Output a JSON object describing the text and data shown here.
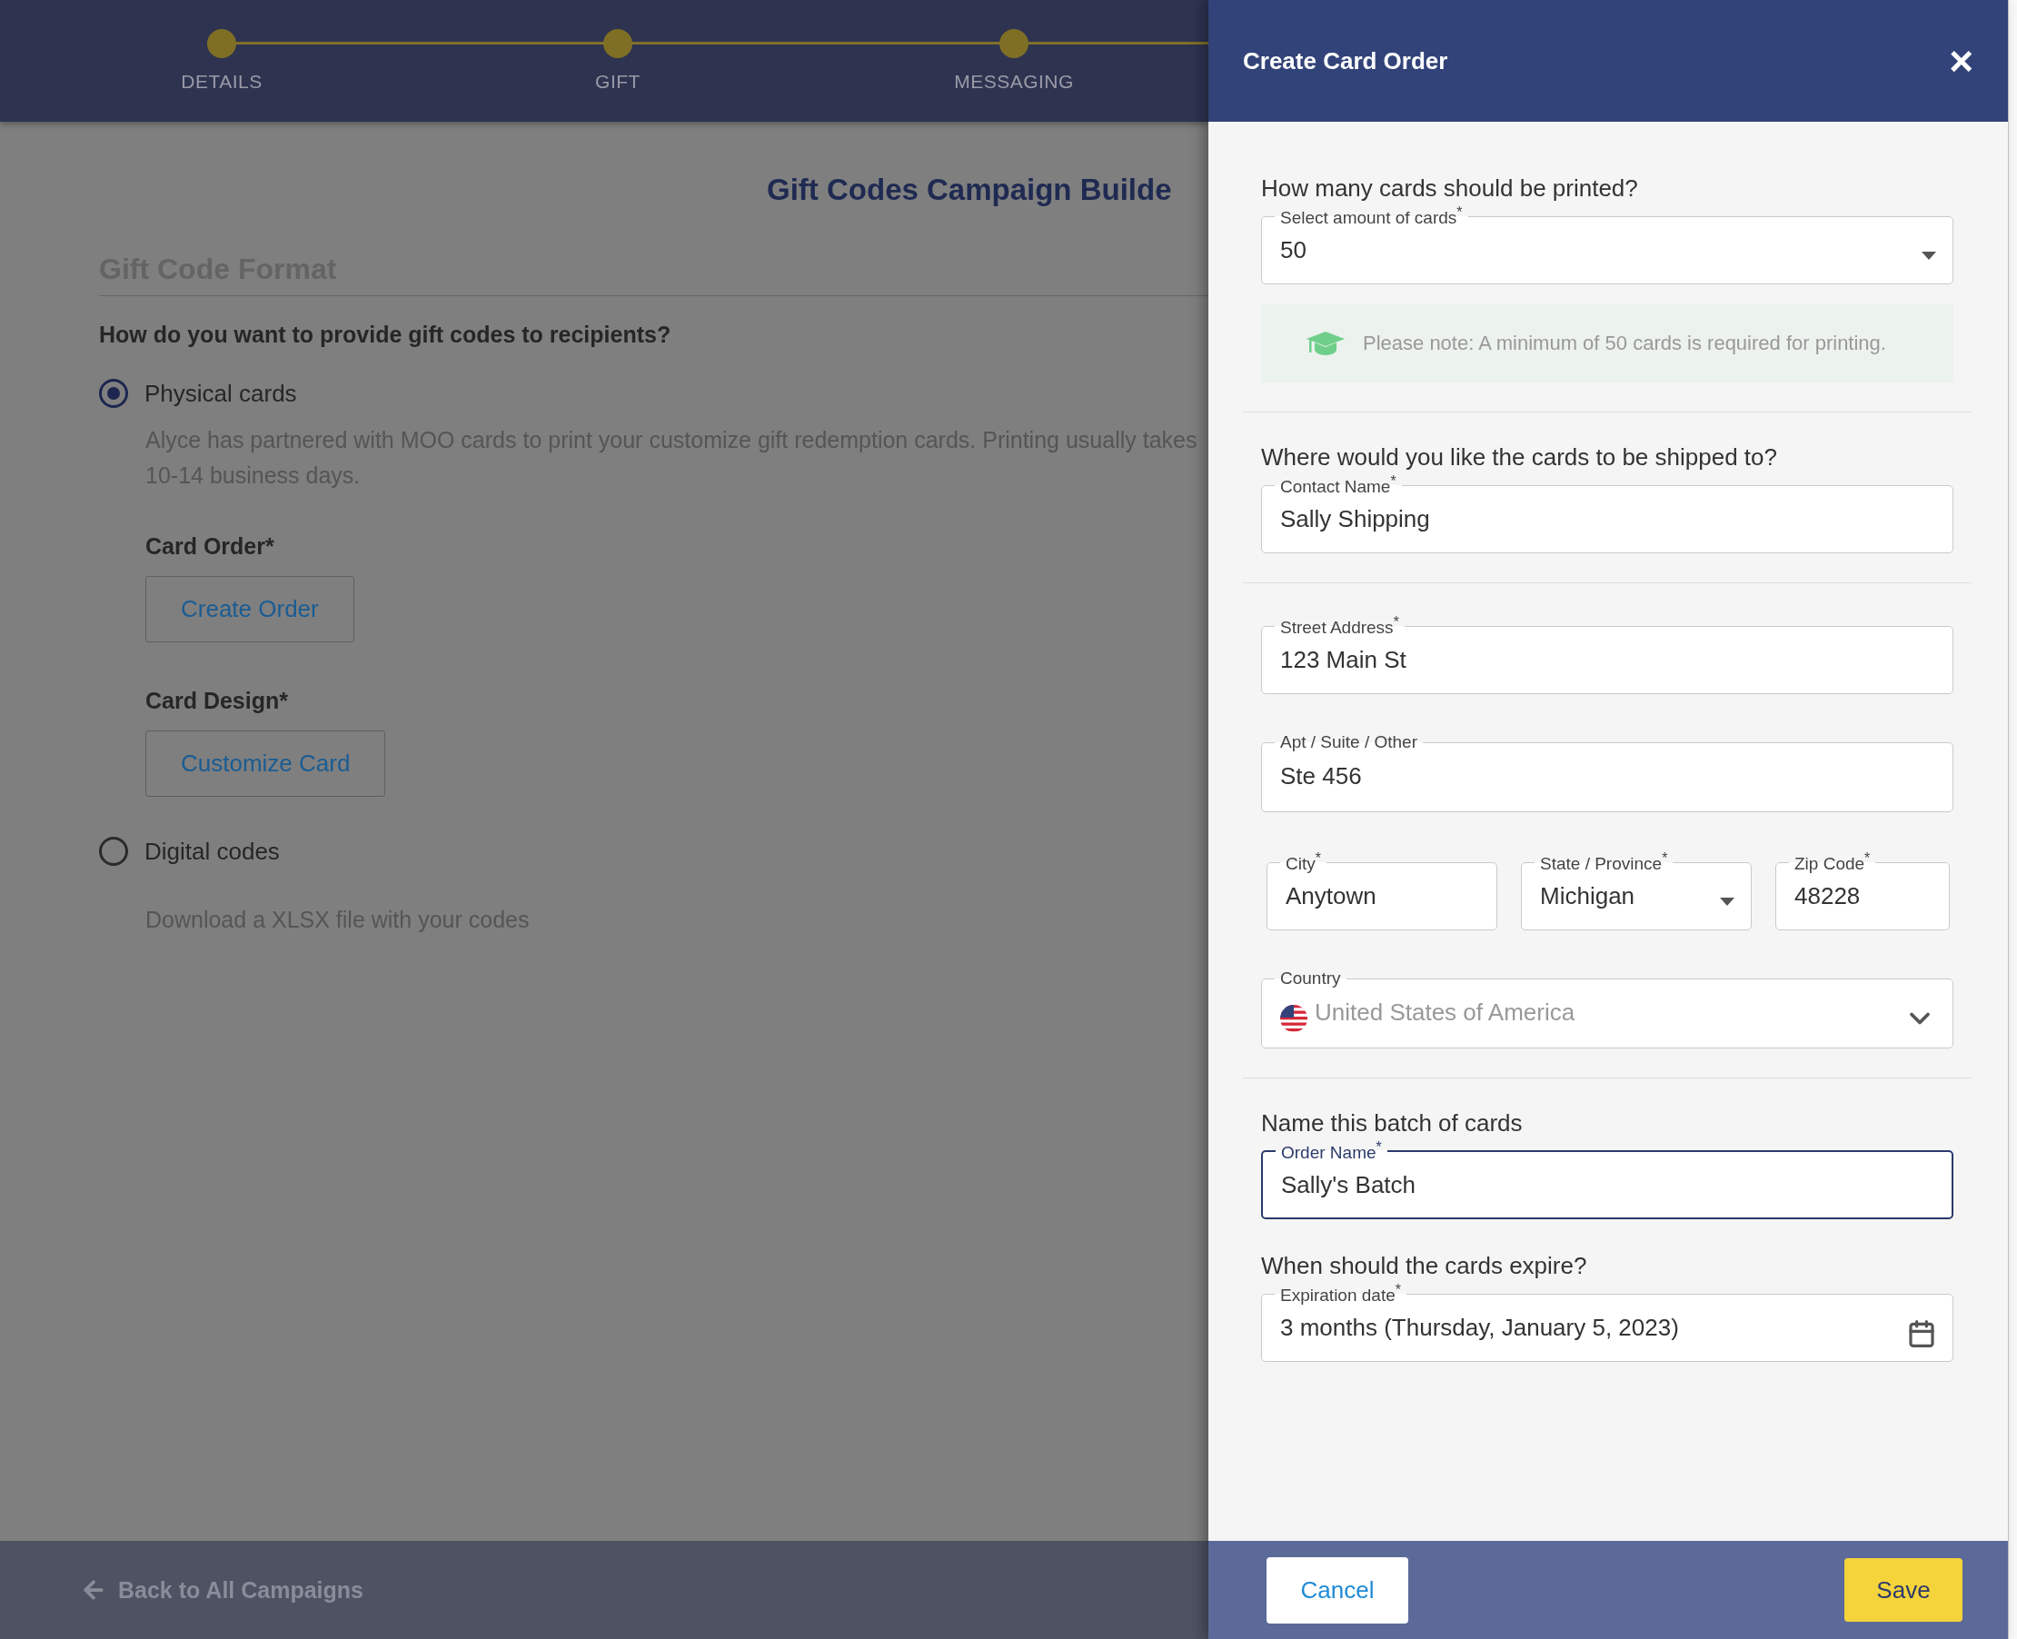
{
  "stepper": {
    "steps": [
      {
        "label": "DETAILS",
        "completed": true
      },
      {
        "label": "GIFT",
        "completed": true
      },
      {
        "label": "MESSAGING",
        "completed": true
      }
    ]
  },
  "page": {
    "title": "Gift Codes Campaign Builde",
    "section_title": "Gift Code Format",
    "question": "How do you want to provide gift codes to recipients?",
    "options": [
      {
        "label": "Physical cards",
        "selected": true,
        "description": "Alyce has partnered with MOO cards to print your customize gift redemption cards. Printing usually takes 10-14 business days.",
        "subsections": [
          {
            "label": "Card Order*",
            "button": "Create Order"
          },
          {
            "label": "Card Design*",
            "button": "Customize Card"
          }
        ]
      },
      {
        "label": "Digital codes",
        "selected": false,
        "description": "Download a XLSX file with your codes"
      }
    ]
  },
  "footer": {
    "back_link": "Back to All Campaigns"
  },
  "drawer": {
    "title": "Create Card Order",
    "close": "×",
    "sections": [
      {
        "groups": [
          {
            "heading": "How many cards should be printed?",
            "rows": [
              {
                "fields": [
                  {
                    "kind": "select",
                    "label": "Select amount of cards$^{*}$",
                    "value": "50",
                    "focused": false,
                    "disabled": false
                  }
                ]
              }
            ]
          }
        ],
        "note": "Please note: A minimum of 50 cards is required for printing."
      },
      {
        "groups": [
          {
            "heading": "Where would you like the cards to be shipped to?",
            "rows": [
              {
                "fields": [
                  {
                    "kind": "text",
                    "label": "Contact Name$^{*}$",
                    "value": "Sally Shipping",
                    "focused": false,
                    "disabled": false
                  }
                ]
              }
            ]
          }
        ]
      },
      {
        "groups": [
          {
            "rows": [
              {
                "fields": [
                  {
                    "kind": "text",
                    "label": "Street Address$^{*}$",
                    "value": "123 Main St",
                    "focused": false,
                    "disabled": false
                  }
                ]
              },
              {
                "fields": [
                  {
                    "kind": "text",
                    "label": "Apt / Suite / Other",
                    "value": "Ste 456",
                    "focused": false,
                    "disabled": false
                  }
                ]
              },
              {
                "fields": [
                  {
                    "kind": "text",
                    "label": "City$^{*}$",
                    "value": "Anytown",
                    "focused": false,
                    "disabled": false
                  },
                  {
                    "kind": "select",
                    "label": "State / Province$^{*}$",
                    "value": "Michigan",
                    "focused": false,
                    "disabled": false
                  },
                  {
                    "kind": "text",
                    "label": "Zip Code$^{*}$",
                    "value": "48228",
                    "focused": false,
                    "disabled": false
                  }
                ]
              },
              {
                "fields": [
                  {
                    "kind": "country",
                    "label": "Country",
                    "value": "United States of America",
                    "focused": false,
                    "disabled": true
                  }
                ]
              }
            ]
          }
        ]
      },
      {
        "groups": [
          {
            "heading": "Name this batch of cards",
            "rows": [
              {
                "fields": [
                  {
                    "kind": "text",
                    "label": "Order Name$^{*}$",
                    "value": "Sally's Batch",
                    "focused": true,
                    "disabled": false
                  }
                ]
              }
            ]
          },
          {
            "heading": "When should the cards expire?",
            "rows": [
              {
                "fields": [
                  {
                    "kind": "date",
                    "label": "Expiration date$^{*}$",
                    "value": "3 months (Thursday, January 5, 2023)",
                    "focused": false,
                    "disabled": false
                  }
                ]
              }
            ]
          }
        ]
      }
    ],
    "cancel": "Cancel",
    "save": "Save"
  }
}
